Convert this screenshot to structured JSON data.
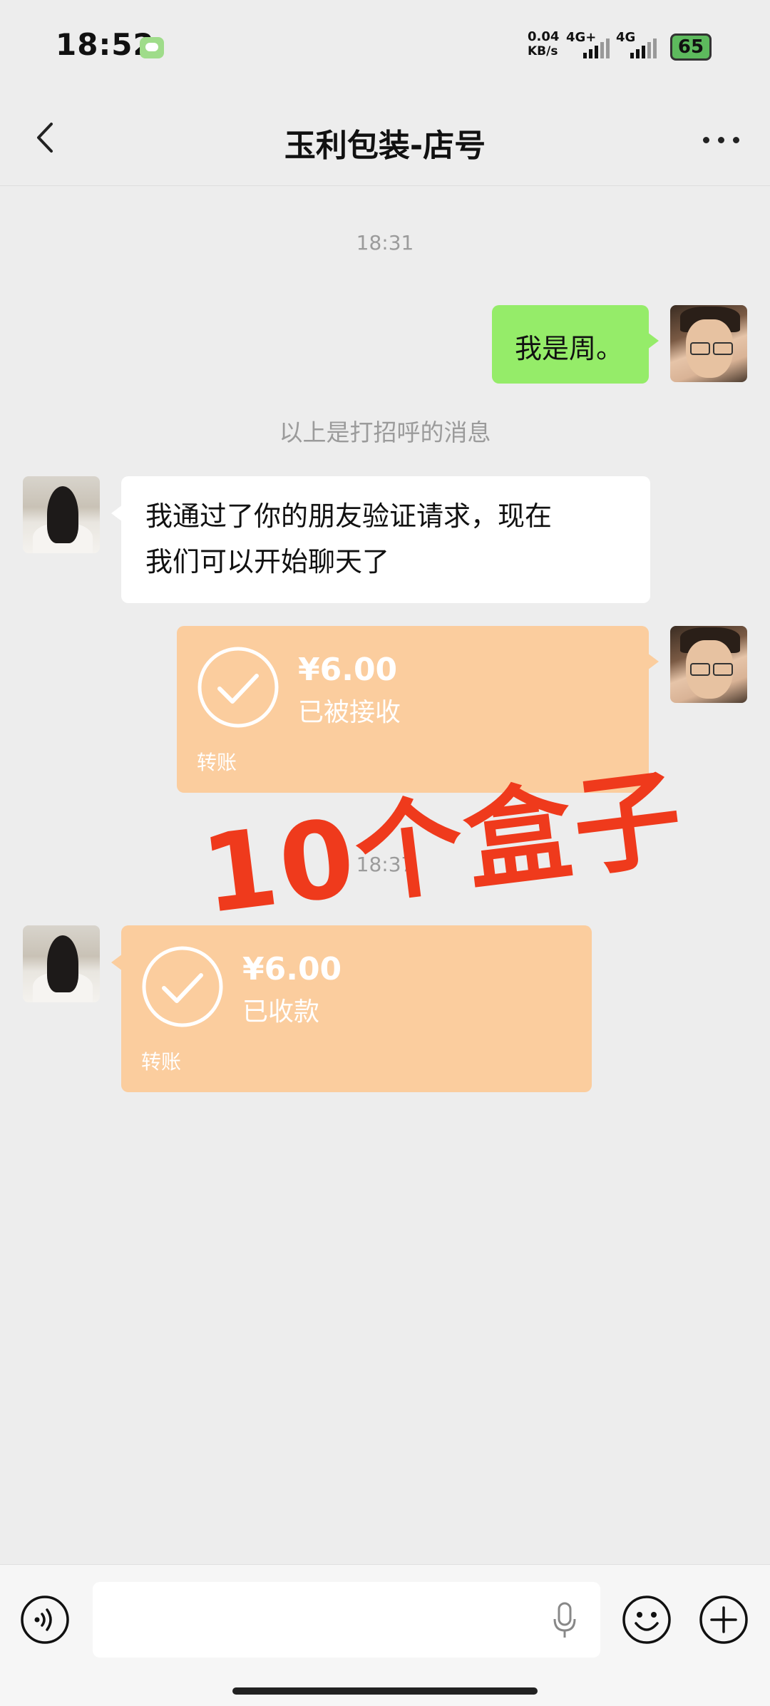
{
  "status_bar": {
    "time": "18:52",
    "net_speed": "0.04",
    "net_unit": "KB/s",
    "net_type_1": "4G+",
    "net_type_2": "4G",
    "battery": "65"
  },
  "header": {
    "title": "玉利包装-店号"
  },
  "chat": {
    "timestamp_1": "18:31",
    "my_greeting": "我是周。",
    "system_notice": "以上是打招呼的消息",
    "their_message_line1": "我通过了你的朋友验证请求，现在",
    "their_message_line2": "我们可以开始聊天了",
    "transfer_sent": {
      "amount": "¥6.00",
      "status": "已被接收",
      "label": "转账"
    },
    "timestamp_2": "18:37",
    "transfer_received": {
      "amount": "¥6.00",
      "status": "已收款",
      "label": "转账"
    },
    "overlay_annotation": "10个盒子"
  },
  "input_bar": {
    "text_value": ""
  },
  "colors": {
    "background": "#ededed",
    "my_bubble": "#95ec69",
    "transfer_card": "#fbcd9e",
    "annotation": "#ef3a1c"
  },
  "icons": {
    "back": "chevron-left-icon",
    "more": "more-dots-icon",
    "voice": "voice-icon",
    "mic": "microphone-icon",
    "emoji": "emoji-icon",
    "plus": "plus-icon",
    "check": "check-circle-icon"
  }
}
